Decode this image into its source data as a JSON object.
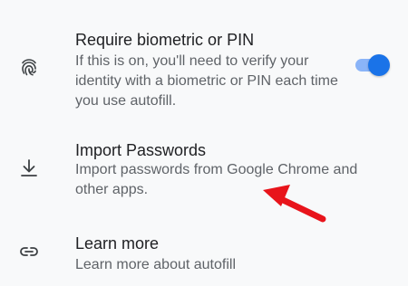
{
  "settings": {
    "biometric": {
      "title": "Require biometric or PIN",
      "description": "If this is on, you'll need to verify your identity with a biometric or PIN each time you use autofill.",
      "icon": "fingerprint-icon",
      "toggle_on": true
    },
    "import": {
      "title": "Import Passwords",
      "description": "Import passwords from Google Chrome and other apps.",
      "icon": "download-icon"
    },
    "learn_more": {
      "title": "Learn more",
      "description": "Learn more about autofill",
      "icon": "link-icon"
    }
  },
  "colors": {
    "accent": "#1a73e8",
    "track": "#8ab4f8",
    "annotation_arrow": "#e8141b"
  }
}
